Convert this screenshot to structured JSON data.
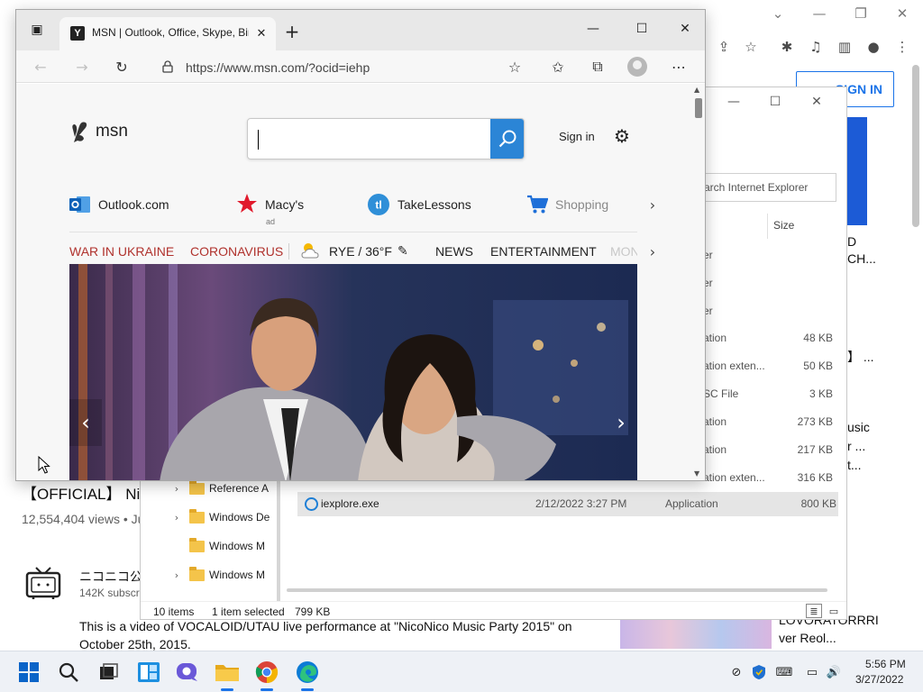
{
  "chrome": {
    "signin_label": "SIGN IN",
    "video_title": "【OFFICIAL】 Ni",
    "views": "12,554,404 views • Ju",
    "channel_name": "ニコニコ公",
    "subs": "142K subscr",
    "description": "This is a video of VOCALOID/UTAU live performance at \"NicoNico Music Party 2015\" on October 25th, 2015.",
    "side_texts": [
      "D",
      "CH...",
      "】 ...",
      "usic",
      "r ...",
      "t..."
    ],
    "rec_title_1": "LOVORATORRRI",
    "rec_title_2": "ver Reol..."
  },
  "explorer": {
    "search_placeholder": "arch Internet Explorer",
    "size_header": "Size",
    "rows": [
      {
        "type": "er",
        "size": ""
      },
      {
        "type": "er",
        "size": ""
      },
      {
        "type": "er",
        "size": ""
      },
      {
        "type": "ation",
        "size": "48 KB"
      },
      {
        "type": "ation exten...",
        "size": "50 KB"
      },
      {
        "type": "SC File",
        "size": "3 KB"
      },
      {
        "type": "ation",
        "size": "273 KB"
      },
      {
        "type": "ation",
        "size": "217 KB"
      },
      {
        "type": "ation exten...",
        "size": "316 KB"
      }
    ],
    "selected": {
      "name": "iexplore.exe",
      "date": "2/12/2022 3:27 PM",
      "type": "Application",
      "size": "800 KB"
    },
    "nav": [
      {
        "label": "Reference A",
        "chevron": true
      },
      {
        "label": "Windows De",
        "chevron": true
      },
      {
        "label": "Windows M",
        "chevron": false
      },
      {
        "label": "Windows M",
        "chevron": true
      }
    ],
    "status": {
      "items": "10 items",
      "selected": "1 item selected",
      "size": "799 KB"
    }
  },
  "edge": {
    "tab_title": "MSN | Outlook, Office, Skype, Bing",
    "url": "https://www.msn.com/?ocid=iehp",
    "msn": {
      "logo_text": "msn",
      "search_value": "",
      "signin": "Sign in",
      "quick_links": [
        {
          "label": "Outlook.com"
        },
        {
          "label": "Macy's",
          "sub": "ad"
        },
        {
          "label": "TakeLessons"
        },
        {
          "label": "Shopping"
        }
      ],
      "nav": {
        "war": "WAR IN UKRAINE",
        "corona": "CORONAVIRUS",
        "weather": "RYE / 36°F",
        "news": "NEWS",
        "entertainment": "ENTERTAINMENT",
        "more": "MON"
      }
    }
  },
  "taskbar": {
    "time": "5:56 PM",
    "date": "3/27/2022"
  },
  "colors": {
    "accent": "#2b85d6",
    "nav_red": "#b0322d",
    "chrome_blue": "#1a73e8"
  }
}
